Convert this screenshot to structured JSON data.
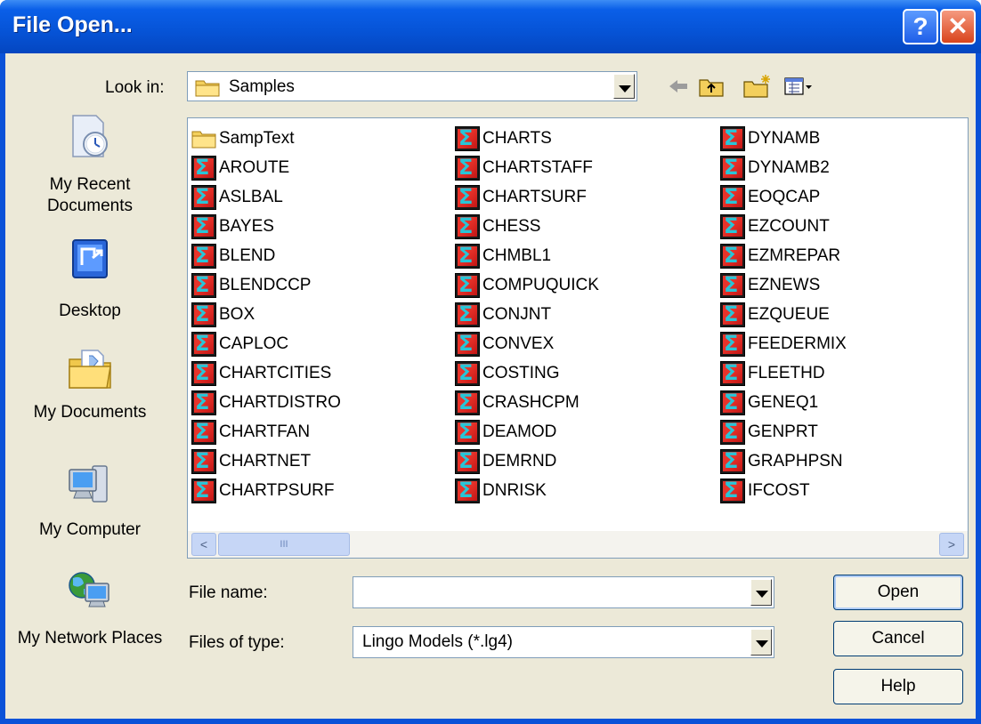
{
  "window": {
    "title": "File Open..."
  },
  "title_buttons": {
    "help": "?",
    "close": "✕"
  },
  "lookin": {
    "label": "Look in:",
    "value": "Samples"
  },
  "places": [
    {
      "label": "My Recent Documents",
      "icon": "recent-documents-icon"
    },
    {
      "label": "Desktop",
      "icon": "desktop-icon"
    },
    {
      "label": "My Documents",
      "icon": "my-documents-icon"
    },
    {
      "label": "My Computer",
      "icon": "my-computer-icon"
    },
    {
      "label": "My Network Places",
      "icon": "network-places-icon"
    }
  ],
  "files": {
    "col1": [
      "SampText",
      "AROUTE",
      "ASLBAL",
      "BAYES",
      "BLEND",
      "BLENDCCP",
      "BOX",
      "CAPLOC",
      "CHARTCITIES",
      "CHARTDISTRO",
      "CHARTFAN",
      "CHARTNET",
      "CHARTPSURF"
    ],
    "col2": [
      "CHARTS",
      "CHARTSTAFF",
      "CHARTSURF",
      "CHESS",
      "CHMBL1",
      "COMPUQUICK",
      "CONJNT",
      "CONVEX",
      "COSTING",
      "CRASHCPM",
      "DEAMOD",
      "DEMRND",
      "DNRISK"
    ],
    "col3": [
      "DYNAMB",
      "DYNAMB2",
      "EOQCAP",
      "EZCOUNT",
      "EZMREPAR",
      "EZNEWS",
      "EZQUEUE",
      "FEEDERMIX",
      "FLEETHD",
      "GENEQ1",
      "GENPRT",
      "GRAPHPSN",
      "IFCOST"
    ]
  },
  "scrollbar": {
    "left_arrow": "<",
    "right_arrow": ">",
    "thumb_grip": "III"
  },
  "filename": {
    "label": "File name:",
    "value": ""
  },
  "filetype": {
    "label": "Files of type:",
    "value": "Lingo Models (*.lg4)"
  },
  "buttons": {
    "open": "Open",
    "cancel": "Cancel",
    "help": "Help"
  },
  "colors": {
    "title_blue": "#0a52d8",
    "dialog_bg": "#ece9d8",
    "close_red": "#d9441c"
  }
}
